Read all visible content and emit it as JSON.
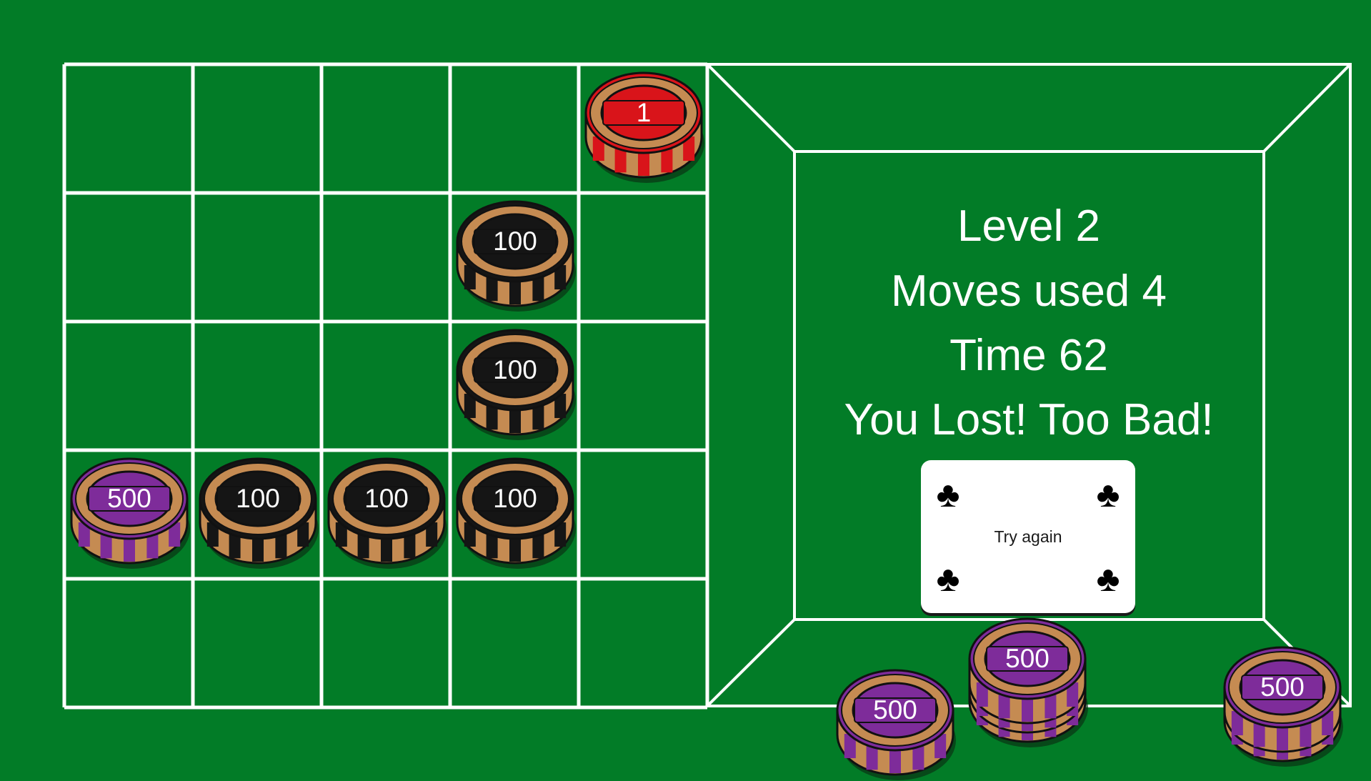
{
  "status": {
    "level": "Level 2",
    "moves": "Moves used 4",
    "time": "Time 62",
    "message": "You Lost! Too Bad!"
  },
  "try_again": {
    "label": "Try again",
    "suit_icon": "club-icon"
  },
  "board": {
    "rows": 5,
    "cols": 5,
    "chips": [
      {
        "row": 0,
        "col": 4,
        "label": "1",
        "color": "red"
      },
      {
        "row": 1,
        "col": 3,
        "label": "100",
        "color": "black"
      },
      {
        "row": 2,
        "col": 3,
        "label": "100",
        "color": "black"
      },
      {
        "row": 3,
        "col": 0,
        "label": "500",
        "color": "purple"
      },
      {
        "row": 3,
        "col": 1,
        "label": "100",
        "color": "black"
      },
      {
        "row": 3,
        "col": 2,
        "label": "100",
        "color": "black"
      },
      {
        "row": 3,
        "col": 3,
        "label": "100",
        "color": "black"
      }
    ]
  },
  "side_stacks": [
    {
      "label": "500",
      "color": "purple",
      "chips": 1
    },
    {
      "label": "500",
      "color": "purple",
      "chips": 3
    },
    {
      "label": "500",
      "color": "purple",
      "chips": 2
    }
  ],
  "colors": {
    "felt": "#027c27",
    "line": "#ffffff",
    "red": "#d9141a",
    "black": "#151515",
    "purple": "#7e2c9a",
    "chip_edge": "#c58b52"
  }
}
